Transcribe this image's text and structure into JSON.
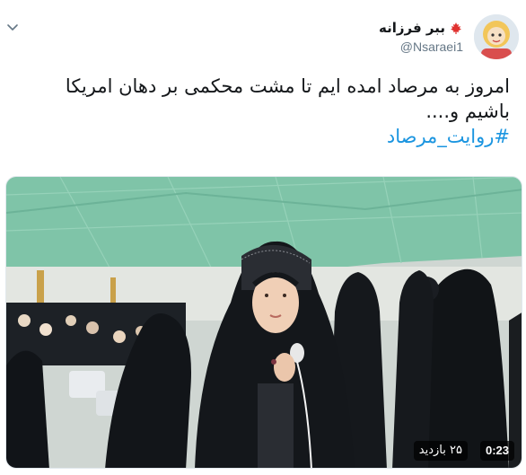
{
  "tweet": {
    "display_name": "ببر فرزانه",
    "handle": "@Nsaraei1",
    "text_line1": "امروز به مرصاد امده ایم تا مشت محکمی بر دهان امریکا",
    "text_line2": "باشیم و....",
    "hashtag": "#روایت_مرصاد",
    "menu_icon": "chevron-down-icon",
    "flag_icon": "canada-flag-icon"
  },
  "media": {
    "type": "video",
    "duration": "0:23",
    "views": "۲۵ بازدید"
  },
  "colors": {
    "link": "#1b95e0",
    "text": "#14171a",
    "secondary": "#657786",
    "canopy": "#7fc4a8"
  }
}
